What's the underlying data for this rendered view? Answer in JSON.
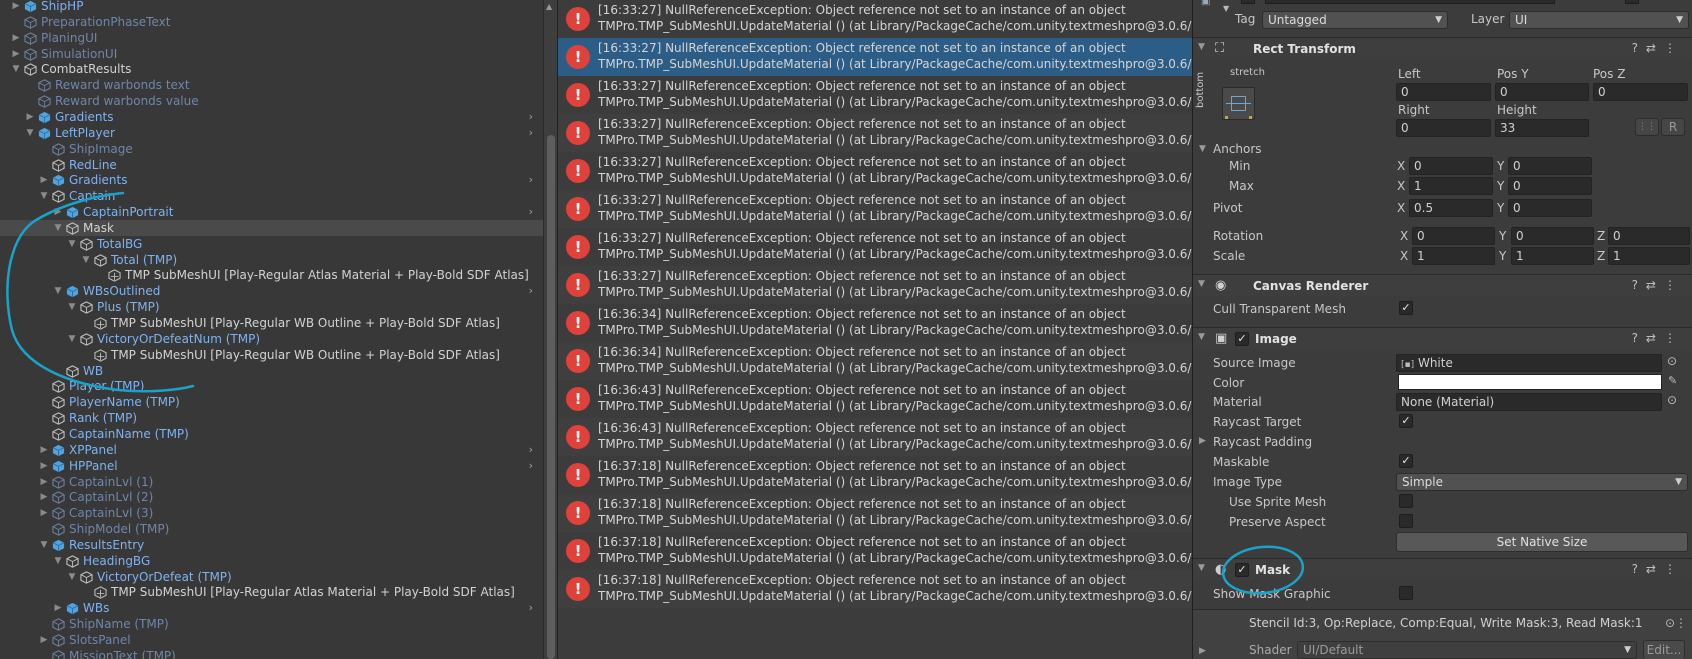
{
  "hierarchy": {
    "rows": [
      {
        "label": "ShipHP",
        "color": "blue",
        "icon": "prefab",
        "indent": 1,
        "expand": "collapsed"
      },
      {
        "label": "PreparationPhaseText",
        "color": "dim",
        "icon": "go",
        "indent": 1,
        "expand": "none"
      },
      {
        "label": "PlaningUI",
        "color": "dim",
        "icon": "go",
        "indent": 1,
        "expand": "collapsed"
      },
      {
        "label": "SimulationUI",
        "color": "dim",
        "icon": "go",
        "indent": 1,
        "expand": "collapsed"
      },
      {
        "label": "CombatResults",
        "color": "white",
        "icon": "go",
        "indent": 1,
        "expand": "expanded"
      },
      {
        "label": "Reward warbonds text",
        "color": "dim",
        "icon": "go",
        "indent": 2,
        "expand": "none"
      },
      {
        "label": "Reward warbonds value",
        "color": "dim",
        "icon": "go",
        "indent": 2,
        "expand": "none"
      },
      {
        "label": "Gradients",
        "color": "blue",
        "icon": "prefab",
        "indent": 2,
        "expand": "collapsed",
        "chev": true
      },
      {
        "label": "LeftPlayer",
        "color": "blue",
        "icon": "prefab",
        "indent": 2,
        "expand": "expanded",
        "chev": true
      },
      {
        "label": "ShipImage",
        "color": "dim",
        "icon": "go",
        "indent": 3,
        "expand": "none"
      },
      {
        "label": "RedLine",
        "color": "blue",
        "icon": "go",
        "indent": 3,
        "expand": "none"
      },
      {
        "label": "Gradients",
        "color": "blue",
        "icon": "prefab",
        "indent": 3,
        "expand": "collapsed",
        "chev": true
      },
      {
        "label": "Captain",
        "color": "blue",
        "icon": "go",
        "indent": 3,
        "expand": "expanded"
      },
      {
        "label": "CaptainPortrait",
        "color": "blue",
        "icon": "prefab",
        "indent": 4,
        "expand": "collapsed",
        "chev": true
      },
      {
        "label": "Mask",
        "color": "white",
        "icon": "go",
        "indent": 4,
        "expand": "expanded",
        "selected": true
      },
      {
        "label": "TotalBG",
        "color": "blue",
        "icon": "go",
        "indent": 5,
        "expand": "expanded"
      },
      {
        "label": "Total (TMP)",
        "color": "blue",
        "icon": "go",
        "indent": 6,
        "expand": "expanded"
      },
      {
        "label": "TMP SubMeshUI [Play-Regular Atlas Material + Play-Bold SDF Atlas]",
        "color": "white",
        "icon": "tmp",
        "indent": 7,
        "expand": "none"
      },
      {
        "label": "WBsOutlined",
        "color": "blue",
        "icon": "prefab",
        "indent": 4,
        "expand": "expanded",
        "chev": true
      },
      {
        "label": "Plus (TMP)",
        "color": "blue",
        "icon": "go",
        "indent": 5,
        "expand": "expanded"
      },
      {
        "label": "TMP SubMeshUI [Play-Regular WB Outline + Play-Bold SDF Atlas]",
        "color": "white",
        "icon": "tmp",
        "indent": 6,
        "expand": "none"
      },
      {
        "label": "VictoryOrDefeatNum (TMP)",
        "color": "blue",
        "icon": "go",
        "indent": 5,
        "expand": "expanded"
      },
      {
        "label": "TMP SubMeshUI [Play-Regular WB Outline + Play-Bold SDF Atlas]",
        "color": "white",
        "icon": "tmp",
        "indent": 6,
        "expand": "none"
      },
      {
        "label": "WB",
        "color": "blue",
        "icon": "go",
        "indent": 4,
        "expand": "none"
      },
      {
        "label": "Player (TMP)",
        "color": "blue",
        "icon": "go",
        "indent": 3,
        "expand": "none"
      },
      {
        "label": "PlayerName (TMP)",
        "color": "blue",
        "icon": "go",
        "indent": 3,
        "expand": "none"
      },
      {
        "label": "Rank (TMP)",
        "color": "blue",
        "icon": "go",
        "indent": 3,
        "expand": "none"
      },
      {
        "label": "CaptainName (TMP)",
        "color": "blue",
        "icon": "go",
        "indent": 3,
        "expand": "none"
      },
      {
        "label": "XPPanel",
        "color": "blue",
        "icon": "prefab",
        "indent": 3,
        "expand": "collapsed",
        "chev": true
      },
      {
        "label": "HPPanel",
        "color": "blue",
        "icon": "prefab",
        "indent": 3,
        "expand": "collapsed",
        "chev": true
      },
      {
        "label": "CaptainLvl (1)",
        "color": "dim",
        "icon": "go",
        "indent": 3,
        "expand": "collapsed"
      },
      {
        "label": "CaptainLvl (2)",
        "color": "dim",
        "icon": "go",
        "indent": 3,
        "expand": "collapsed"
      },
      {
        "label": "CaptainLvl (3)",
        "color": "dim",
        "icon": "go",
        "indent": 3,
        "expand": "collapsed"
      },
      {
        "label": "ShipModel (TMP)",
        "color": "dim",
        "icon": "go",
        "indent": 3,
        "expand": "none"
      },
      {
        "label": "ResultsEntry",
        "color": "blue",
        "icon": "prefab",
        "indent": 3,
        "expand": "expanded"
      },
      {
        "label": "HeadingBG",
        "color": "blue",
        "icon": "go",
        "indent": 4,
        "expand": "expanded"
      },
      {
        "label": "VictoryOrDefeat (TMP)",
        "color": "blue",
        "icon": "go",
        "indent": 5,
        "expand": "expanded"
      },
      {
        "label": "TMP SubMeshUI [Play-Regular Atlas Material + Play-Bold SDF Atlas]",
        "color": "white",
        "icon": "tmp",
        "indent": 6,
        "expand": "none"
      },
      {
        "label": "WBs",
        "color": "blue",
        "icon": "prefab",
        "indent": 4,
        "expand": "collapsed",
        "chev": true
      },
      {
        "label": "ShipName (TMP)",
        "color": "dim",
        "icon": "go",
        "indent": 3,
        "expand": "none"
      },
      {
        "label": "SlotsPanel",
        "color": "dim",
        "icon": "go",
        "indent": 3,
        "expand": "collapsed"
      },
      {
        "label": "MissionText (TMP)",
        "color": "dim",
        "icon": "go",
        "indent": 3,
        "expand": "none"
      }
    ]
  },
  "console": {
    "line2": "TMPro.TMP_SubMeshUI.UpdateMaterial () (at Library/PackageCache/com.unity.textmeshpro@3.0.6/Scrip",
    "error_icon": "!",
    "logs": [
      "[16:33:27] NullReferenceException: Object reference not set to an instance of an object",
      "[16:33:27] NullReferenceException: Object reference not set to an instance of an object",
      "[16:33:27] NullReferenceException: Object reference not set to an instance of an object",
      "[16:33:27] NullReferenceException: Object reference not set to an instance of an object",
      "[16:33:27] NullReferenceException: Object reference not set to an instance of an object",
      "[16:33:27] NullReferenceException: Object reference not set to an instance of an object",
      "[16:33:27] NullReferenceException: Object reference not set to an instance of an object",
      "[16:33:27] NullReferenceException: Object reference not set to an instance of an object",
      "[16:36:34] NullReferenceException: Object reference not set to an instance of an object",
      "[16:36:34] NullReferenceException: Object reference not set to an instance of an object",
      "[16:36:43] NullReferenceException: Object reference not set to an instance of an object",
      "[16:36:43] NullReferenceException: Object reference not set to an instance of an object",
      "[16:37:18] NullReferenceException: Object reference not set to an instance of an object",
      "[16:37:18] NullReferenceException: Object reference not set to an instance of an object",
      "[16:37:18] NullReferenceException: Object reference not set to an instance of an object",
      "[16:37:18] NullReferenceException: Object reference not set to an instance of an object"
    ],
    "selected_index": 1
  },
  "inspector": {
    "tag_label": "Tag",
    "tag_value": "Untagged",
    "layer_label": "Layer",
    "layer_value": "UI",
    "rect": {
      "title": "Rect Transform",
      "stretch": "stretch",
      "bottom": "bottom",
      "left_label": "Left",
      "left_value": "0",
      "posy_label": "Pos Y",
      "posy_value": "0",
      "posz_label": "Pos Z",
      "posz_value": "0",
      "right_label": "Right",
      "right_value": "0",
      "height_label": "Height",
      "height_value": "33",
      "r_button": "R",
      "anchors_label": "Anchors",
      "min_label": "Min",
      "min_x": "0",
      "min_y": "0",
      "max_label": "Max",
      "max_x": "1",
      "max_y": "0",
      "pivot_label": "Pivot",
      "pivot_x": "0.5",
      "pivot_y": "0",
      "rotation_label": "Rotation",
      "rot_x": "0",
      "rot_y": "0",
      "rot_z": "0",
      "scale_label": "Scale",
      "scale_x": "1",
      "scale_y": "1",
      "scale_z": "1",
      "x": "X",
      "y": "Y",
      "z": "Z"
    },
    "canvas_renderer": {
      "title": "Canvas Renderer",
      "cull_label": "Cull Transparent Mesh"
    },
    "image": {
      "title": "Image",
      "source_label": "Source Image",
      "source_value": "White",
      "color_label": "Color",
      "material_label": "Material",
      "material_value": "None (Material)",
      "raycast_target_label": "Raycast Target",
      "raycast_padding_label": "Raycast Padding",
      "maskable_label": "Maskable",
      "image_type_label": "Image Type",
      "image_type_value": "Simple",
      "use_sprite_mesh_label": "Use Sprite Mesh",
      "preserve_aspect_label": "Preserve Aspect",
      "native_size_button": "Set Native Size"
    },
    "mask": {
      "title": "Mask",
      "show_graphic_label": "Show Mask Graphic"
    },
    "stencil": "Stencil Id:3, Op:Replace, Comp:Equal, Write Mask:3, Read Mask:1",
    "shader_label": "Shader",
    "shader_value": "UI/Default",
    "edit_button": "Edit..."
  },
  "colors": {
    "annotation": "#1aa3c8",
    "selection": "#2c5d87",
    "error": "#e0413a"
  }
}
